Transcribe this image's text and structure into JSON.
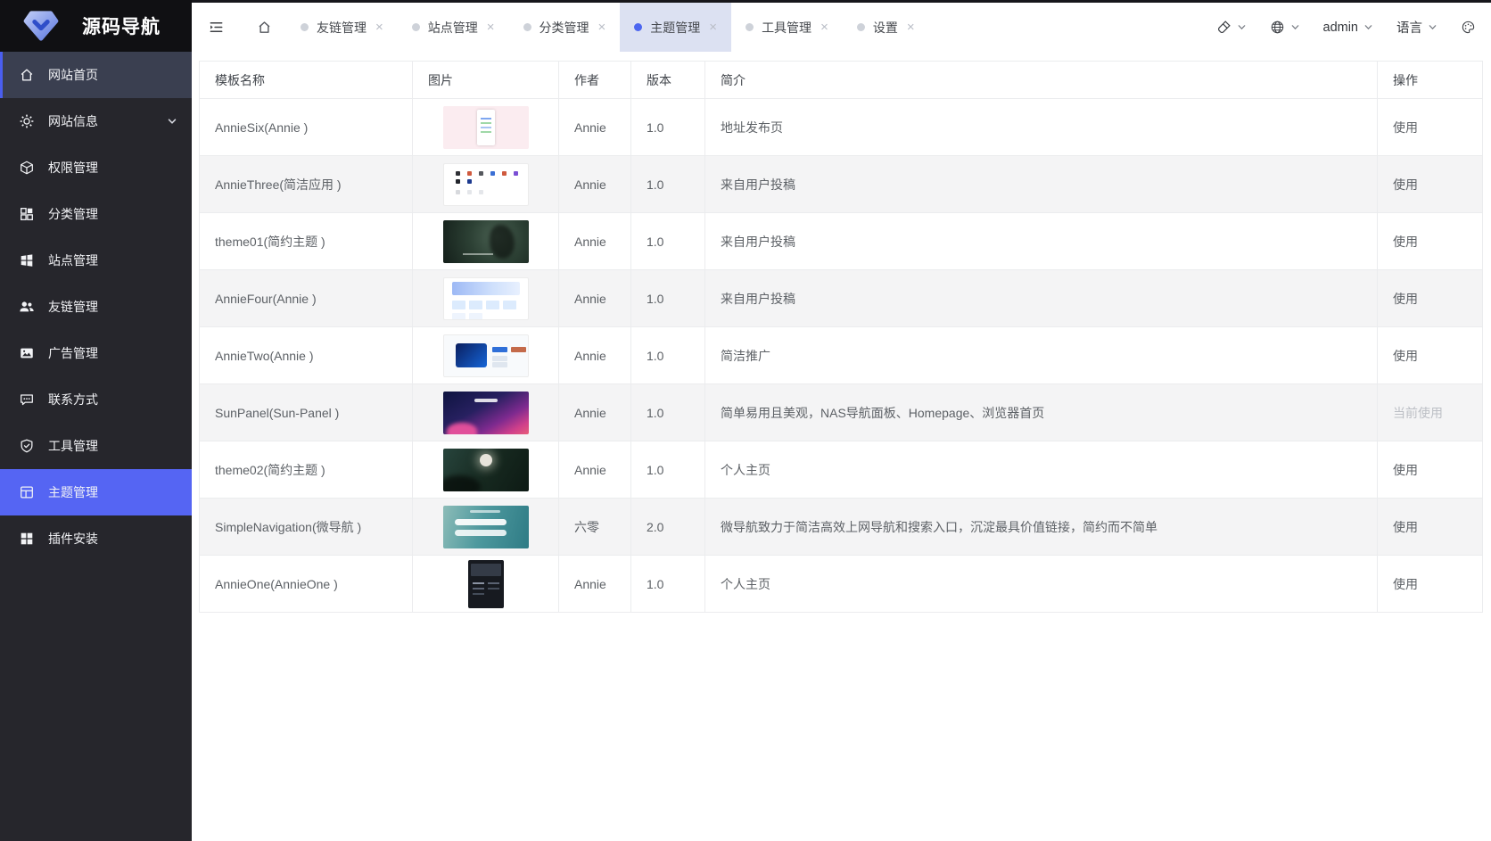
{
  "app": {
    "title": "源码导航"
  },
  "sidebar": {
    "items": [
      {
        "label": "网站首页",
        "icon": "home-icon",
        "state": "highlighted"
      },
      {
        "label": "网站信息",
        "icon": "gear-icon",
        "expandable": true
      },
      {
        "label": "权限管理",
        "icon": "cube-icon"
      },
      {
        "label": "分类管理",
        "icon": "grid-icon"
      },
      {
        "label": "站点管理",
        "icon": "windows-icon"
      },
      {
        "label": "友链管理",
        "icon": "users-icon"
      },
      {
        "label": "广告管理",
        "icon": "image-icon"
      },
      {
        "label": "联系方式",
        "icon": "chat-bubble-icon"
      },
      {
        "label": "工具管理",
        "icon": "shield-check-icon"
      },
      {
        "label": "主题管理",
        "icon": "layout-icon",
        "state": "active"
      },
      {
        "label": "插件安装",
        "icon": "plugin-grid-icon"
      }
    ]
  },
  "topbar": {
    "tabs": [
      {
        "label": "友链管理",
        "active": false
      },
      {
        "label": "站点管理",
        "active": false
      },
      {
        "label": "分类管理",
        "active": false
      },
      {
        "label": "主题管理",
        "active": true
      },
      {
        "label": "工具管理",
        "active": false
      },
      {
        "label": "设置",
        "active": false
      }
    ],
    "user": "admin",
    "language_label": "语言"
  },
  "icons": {
    "close_glyph": "×"
  },
  "table": {
    "columns": [
      "模板名称",
      "图片",
      "作者",
      "版本",
      "简介",
      "操作"
    ],
    "rows": [
      {
        "name": "AnnieSix(Annie )",
        "author": "Annie",
        "version": "1.0",
        "intro": "地址发布页",
        "action": "使用",
        "action_state": "enabled"
      },
      {
        "name": "AnnieThree(简洁应用 )",
        "author": "Annie",
        "version": "1.0",
        "intro": "来自用户投稿",
        "action": "使用",
        "action_state": "enabled"
      },
      {
        "name": "theme01(简约主题 )",
        "author": "Annie",
        "version": "1.0",
        "intro": "来自用户投稿",
        "action": "使用",
        "action_state": "enabled"
      },
      {
        "name": "AnnieFour(Annie )",
        "author": "Annie",
        "version": "1.0",
        "intro": "来自用户投稿",
        "action": "使用",
        "action_state": "enabled"
      },
      {
        "name": "AnnieTwo(Annie )",
        "author": "Annie",
        "version": "1.0",
        "intro": "简洁推广",
        "action": "使用",
        "action_state": "enabled"
      },
      {
        "name": "SunPanel(Sun-Panel )",
        "author": "Annie",
        "version": "1.0",
        "intro": "简单易用且美观，NAS导航面板、Homepage、浏览器首页",
        "action": "当前使用",
        "action_state": "current"
      },
      {
        "name": "theme02(简约主题 )",
        "author": "Annie",
        "version": "1.0",
        "intro": "个人主页",
        "action": "使用",
        "action_state": "enabled"
      },
      {
        "name": "SimpleNavigation(微导航 )",
        "author": "六零",
        "version": "2.0",
        "intro": "微导航致力于简洁高效上网导航和搜索入口，沉淀最具价值链接，简约而不简单",
        "action": "使用",
        "action_state": "enabled"
      },
      {
        "name": "AnnieOne(AnnieOne )",
        "author": "Annie",
        "version": "1.0",
        "intro": "个人主页",
        "action": "使用",
        "action_state": "enabled"
      }
    ]
  },
  "colors": {
    "sidebar_bg": "#26262c",
    "sidebar_active_bg": "#5565f3",
    "sidebar_highlight_bg": "#3a3f50",
    "accent_blue": "#4c66f0",
    "tab_active_bg": "#dce1f2",
    "row_stripe": "#f4f4f5",
    "disabled_text": "#bcbfc5"
  }
}
